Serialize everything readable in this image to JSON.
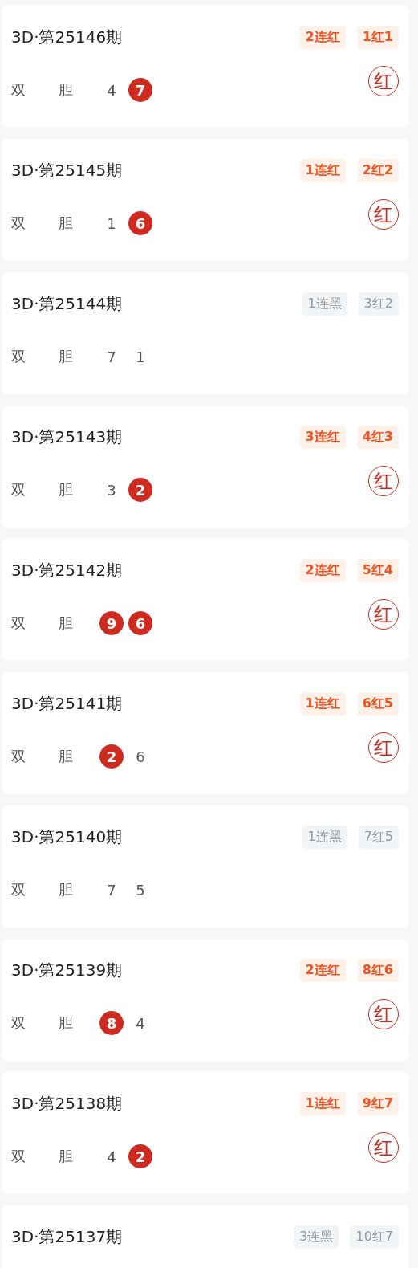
{
  "draws": [
    {
      "title": "3D·第25146期",
      "tags": [
        {
          "text": "2连红",
          "kind": "red"
        },
        {
          "text": "1红1",
          "kind": "red"
        }
      ],
      "labels": [
        "双",
        "胆"
      ],
      "numbers": [
        {
          "text": "4",
          "highlighted": false
        },
        {
          "text": "7",
          "highlighted": true
        }
      ],
      "stamp": "红"
    },
    {
      "title": "3D·第25145期",
      "tags": [
        {
          "text": "1连红",
          "kind": "red"
        },
        {
          "text": "2红2",
          "kind": "red"
        }
      ],
      "labels": [
        "双",
        "胆"
      ],
      "numbers": [
        {
          "text": "1",
          "highlighted": false
        },
        {
          "text": "6",
          "highlighted": true
        }
      ],
      "stamp": "红"
    },
    {
      "title": "3D·第25144期",
      "tags": [
        {
          "text": "1连黑",
          "kind": "black"
        },
        {
          "text": "3红2",
          "kind": "black"
        }
      ],
      "labels": [
        "双",
        "胆"
      ],
      "numbers": [
        {
          "text": "7",
          "highlighted": false
        },
        {
          "text": "1",
          "highlighted": false
        }
      ]
    },
    {
      "title": "3D·第25143期",
      "tags": [
        {
          "text": "3连红",
          "kind": "red"
        },
        {
          "text": "4红3",
          "kind": "red"
        }
      ],
      "labels": [
        "双",
        "胆"
      ],
      "numbers": [
        {
          "text": "3",
          "highlighted": false
        },
        {
          "text": "2",
          "highlighted": true
        }
      ],
      "stamp": "红"
    },
    {
      "title": "3D·第25142期",
      "tags": [
        {
          "text": "2连红",
          "kind": "red"
        },
        {
          "text": "5红4",
          "kind": "red"
        }
      ],
      "labels": [
        "双",
        "胆"
      ],
      "numbers": [
        {
          "text": "9",
          "highlighted": true
        },
        {
          "text": "6",
          "highlighted": true
        }
      ],
      "stamp": "红"
    },
    {
      "title": "3D·第25141期",
      "tags": [
        {
          "text": "1连红",
          "kind": "red"
        },
        {
          "text": "6红5",
          "kind": "red"
        }
      ],
      "labels": [
        "双",
        "胆"
      ],
      "numbers": [
        {
          "text": "2",
          "highlighted": true
        },
        {
          "text": "6",
          "highlighted": false
        }
      ],
      "stamp": "红"
    },
    {
      "title": "3D·第25140期",
      "tags": [
        {
          "text": "1连黑",
          "kind": "black"
        },
        {
          "text": "7红5",
          "kind": "black"
        }
      ],
      "labels": [
        "双",
        "胆"
      ],
      "numbers": [
        {
          "text": "7",
          "highlighted": false
        },
        {
          "text": "5",
          "highlighted": false
        }
      ]
    },
    {
      "title": "3D·第25139期",
      "tags": [
        {
          "text": "2连红",
          "kind": "red"
        },
        {
          "text": "8红6",
          "kind": "red"
        }
      ],
      "labels": [
        "双",
        "胆"
      ],
      "numbers": [
        {
          "text": "8",
          "highlighted": true
        },
        {
          "text": "4",
          "highlighted": false
        }
      ],
      "stamp": "红"
    },
    {
      "title": "3D·第25138期",
      "tags": [
        {
          "text": "1连红",
          "kind": "red"
        },
        {
          "text": "9红7",
          "kind": "red"
        }
      ],
      "labels": [
        "双",
        "胆"
      ],
      "numbers": [
        {
          "text": "4",
          "highlighted": false
        },
        {
          "text": "2",
          "highlighted": true
        }
      ],
      "stamp": "红"
    },
    {
      "title": "3D·第25137期",
      "tags": [
        {
          "text": "3连黑",
          "kind": "black"
        },
        {
          "text": "10红7",
          "kind": "black"
        }
      ]
    }
  ]
}
